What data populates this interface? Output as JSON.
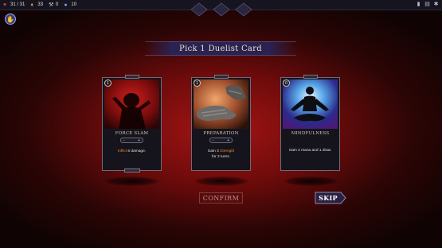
{
  "topbar": {
    "health": "31 / 31",
    "flames": "33",
    "picks": "0",
    "gems": "10",
    "icons": [
      "heart-icon",
      "flame-icon",
      "pickaxe-icon",
      "gem-icon"
    ]
  },
  "header": {
    "title": "Pick 1 Duelist Card"
  },
  "cards": [
    {
      "cost": "1",
      "name": "FORCE SLAM",
      "stepper_minus": "-",
      "stepper_plus": "+",
      "desc_hl": "Inflict",
      "desc_rest": " 6 damage.",
      "line2": ""
    },
    {
      "cost": "1",
      "name": "PREPARATION",
      "stepper_minus": "-",
      "stepper_plus": "+",
      "desc_pre": "Gain 3 ",
      "desc_hl": "Strength",
      "line2": "for 2 turns."
    },
    {
      "cost": "0",
      "name": "MINDFULNESS",
      "stepper_minus": "",
      "stepper_plus": "",
      "desc_full": "Gain 2 mana and 1 draw."
    }
  ],
  "actions": {
    "confirm": "CONFIRM",
    "skip": "SKIP"
  },
  "colors": {
    "background": "#a31414",
    "accent": "#f08a28",
    "banner": "#2a2250"
  }
}
